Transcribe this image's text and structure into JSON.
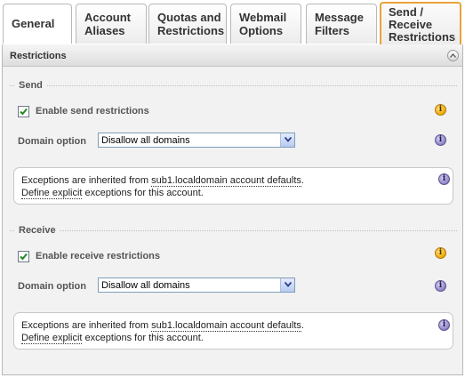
{
  "tabs": [
    {
      "line1": "General",
      "line2": ""
    },
    {
      "line1": "Account",
      "line2": "Aliases"
    },
    {
      "line1": "Quotas and",
      "line2": "Restrictions"
    },
    {
      "line1": "Webmail",
      "line2": "Options"
    },
    {
      "line1": "Message",
      "line2": "Filters"
    },
    {
      "line1": "Send /",
      "line2": "Receive",
      "line3": "Restrictions"
    }
  ],
  "active_tab": "Send / Receive Restrictions",
  "panel": {
    "title": "Restrictions",
    "collapse_icon": "chevron-up-icon"
  },
  "send": {
    "legend": "Send",
    "checkbox_label": "Enable send restrictions",
    "checked": true,
    "domain_label": "Domain option",
    "domain_value": "Disallow all domains",
    "info_prefix": "Exceptions are inherited from ",
    "info_link": "sub1.localdomain account defaults",
    "info_suffix": ".",
    "define_link": "Define explicit",
    "define_suffix": " exceptions for this account."
  },
  "receive": {
    "legend": "Receive",
    "checkbox_label": "Enable receive restrictions",
    "checked": true,
    "domain_label": "Domain option",
    "domain_value": "Disallow all domains",
    "info_prefix": "Exceptions are inherited from ",
    "info_link": "sub1.localdomain account defaults",
    "info_suffix": ".",
    "define_link": "Define explicit",
    "define_suffix": " exceptions for this account."
  },
  "colors": {
    "active_tab_border": "#e8a23c",
    "panel_bg": "#f2f2f2",
    "info_gold": "#f0a800",
    "info_purple": "#8c82c6"
  },
  "icons": {
    "info_glyph": "i"
  }
}
